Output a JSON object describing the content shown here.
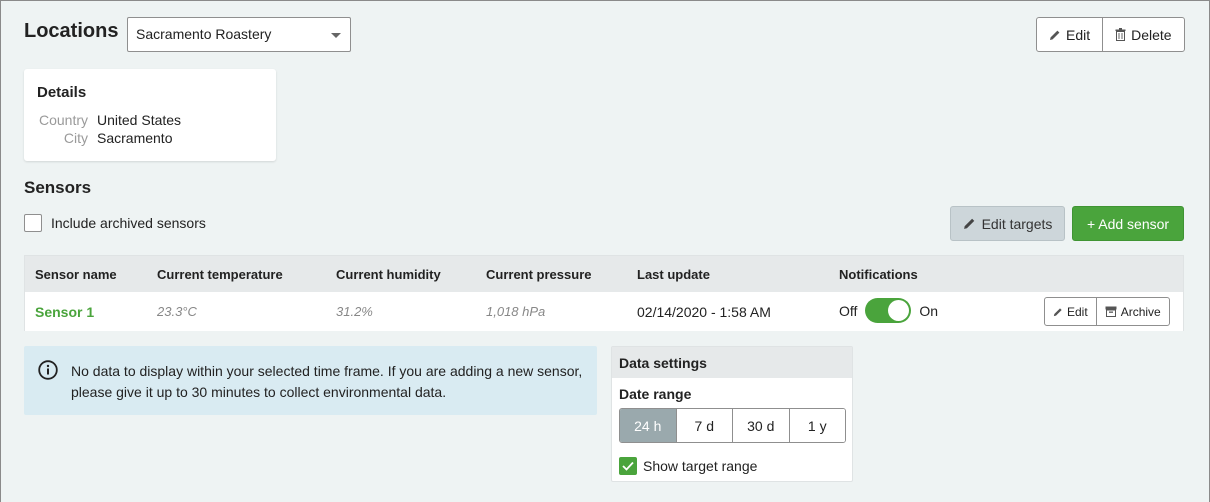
{
  "header": {
    "title": "Locations",
    "location_selected": "Sacramento Roastery",
    "edit_label": "Edit",
    "delete_label": "Delete"
  },
  "details": {
    "title": "Details",
    "rows": [
      {
        "key": "Country",
        "value": "United States"
      },
      {
        "key": "City",
        "value": "Sacramento"
      }
    ]
  },
  "sensors": {
    "title": "Sensors",
    "include_archived_label": "Include archived sensors",
    "include_archived_checked": false,
    "edit_targets_label": "Edit targets",
    "add_sensor_label": "+ Add sensor",
    "columns": [
      "Sensor name",
      "Current temperature",
      "Current humidity",
      "Current pressure",
      "Last update",
      "Notifications"
    ],
    "rows": [
      {
        "name": "Sensor 1",
        "temperature": "23.3°C",
        "humidity": "31.2%",
        "pressure": "1,018 hPa",
        "last_update": "02/14/2020 - 1:58 AM",
        "notif_off_label": "Off",
        "notif_on_label": "On",
        "notifications_on": true,
        "edit_label": "Edit",
        "archive_label": "Archive"
      }
    ]
  },
  "info": {
    "message": "No data to display within your selected time frame. If you are adding a new sensor, please give it up to 30 minutes to collect environmental data."
  },
  "data_settings": {
    "title": "Data settings",
    "date_range_label": "Date range",
    "ranges": [
      "24 h",
      "7 d",
      "30 d",
      "1 y"
    ],
    "selected_range": "24 h",
    "show_target_label": "Show target range",
    "show_target_checked": true
  },
  "colors": {
    "accent_green": "#4aa43c",
    "info_bg": "#d9ebf2",
    "active_range": "#9aa9ad"
  }
}
